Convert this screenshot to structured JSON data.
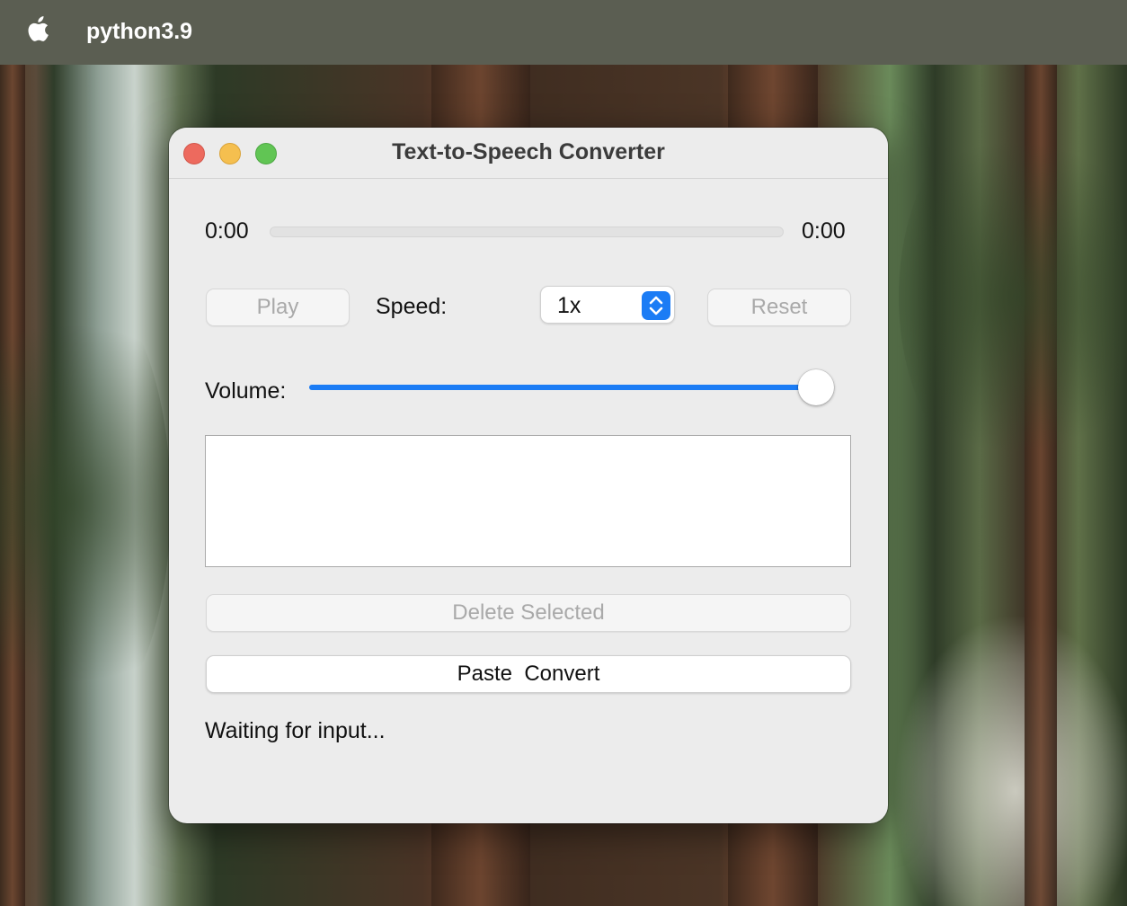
{
  "menubar": {
    "app_name": "python3.9"
  },
  "window": {
    "title": "Text-to-Speech Converter"
  },
  "player": {
    "elapsed": "0:00",
    "total": "0:00",
    "progress": 0
  },
  "controls": {
    "play_label": "Play",
    "speed_label": "Speed:",
    "speed_value": "1x",
    "reset_label": "Reset",
    "volume_label": "Volume:",
    "volume_level": 1.0
  },
  "text_input": {
    "value": ""
  },
  "actions": {
    "delete_label": "Delete Selected",
    "convert_label": "Paste  Convert"
  },
  "status": {
    "text": "Waiting for input..."
  },
  "colors": {
    "accent": "#1b7cf5",
    "close": "#ed6a5e",
    "minimize": "#f5bf4f",
    "zoom": "#61c554"
  }
}
